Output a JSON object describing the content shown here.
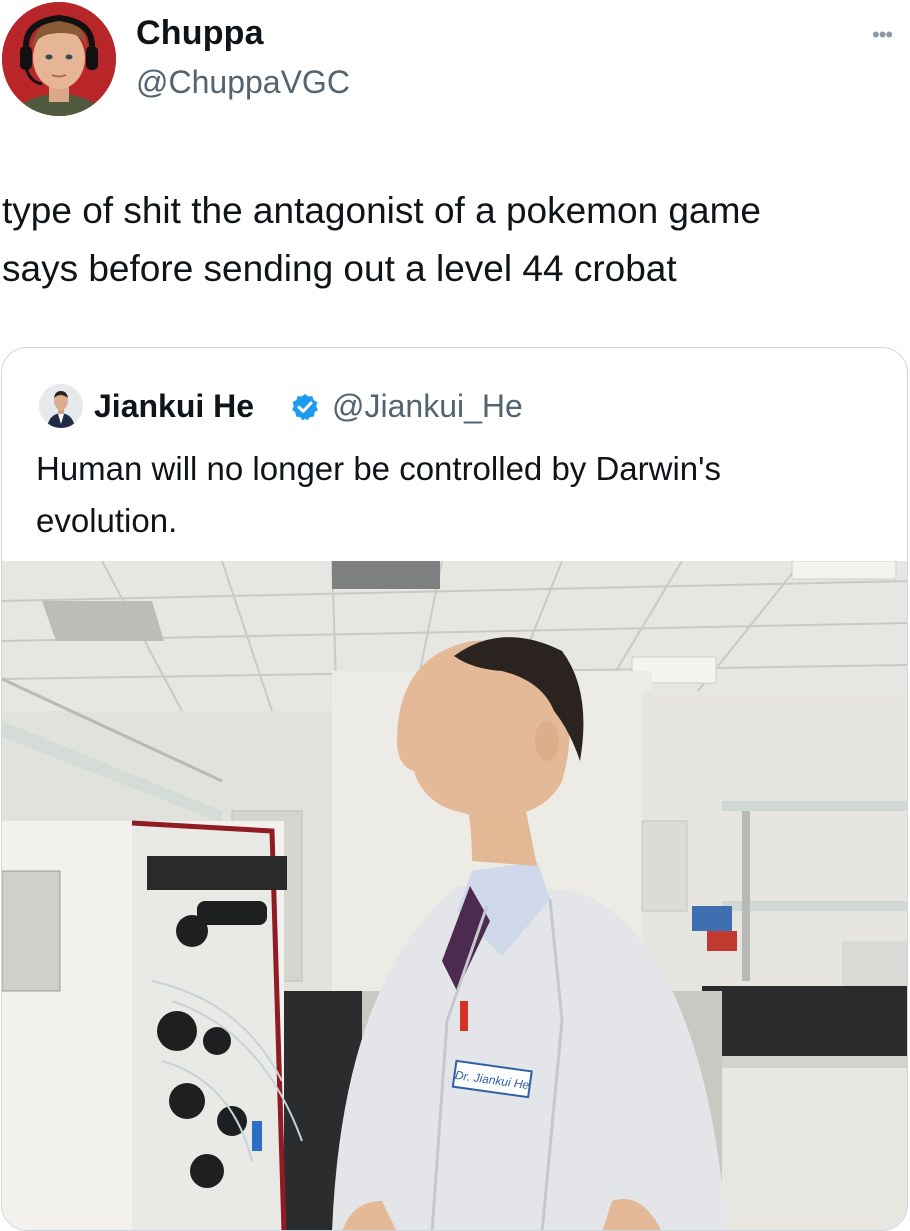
{
  "post": {
    "author": {
      "display_name": "Chuppa",
      "handle": "@ChuppaVGC"
    },
    "more_icon": "more-horizontal-icon",
    "text": "type of shit the antagonist of a pokemon game\nsays before sending out a level 44 crobat"
  },
  "quoted_post": {
    "author": {
      "display_name": "Jiankui He",
      "handle": "@Jiankui_He",
      "verified": true
    },
    "verified_icon": "verified-badge-icon",
    "text": "Human will no longer be controlled by Darwin's\nevolution.",
    "photo": {
      "name_tag": "Dr. Jiankui He"
    }
  },
  "colors": {
    "text_primary": "#0f1419",
    "text_secondary": "#536471",
    "border": "#d0d7dc",
    "verified_blue": "#1d9bf0",
    "avatar_bg": "#b8262a"
  }
}
